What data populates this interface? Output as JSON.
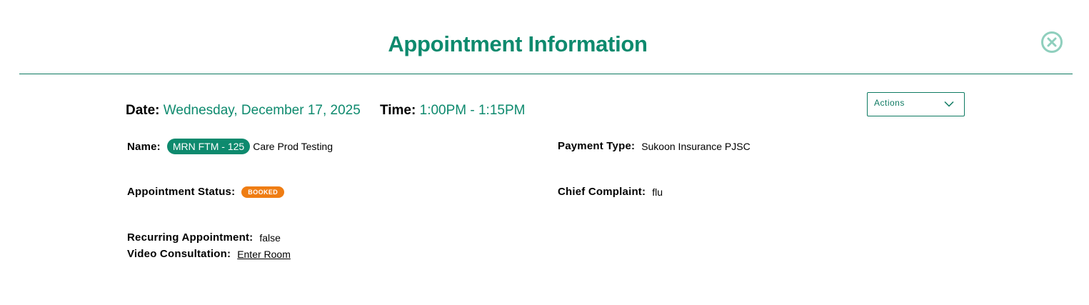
{
  "modal": {
    "title": "Appointment Information",
    "close_icon": "close-circle-icon"
  },
  "schedule": {
    "date_label": "Date:",
    "date_value": "Wednesday, December 17, 2025",
    "time_label": "Time:",
    "time_value": "1:00PM - 1:15PM"
  },
  "actions": {
    "label": "Actions",
    "icon": "chevron-down-icon"
  },
  "details": {
    "name_label": "Name:",
    "mrn_badge": "MRN FTM - 125",
    "name_value": "Care Prod Testing",
    "payment_label": "Payment Type:",
    "payment_value": "Sukoon Insurance PJSC",
    "status_label": "Appointment Status:",
    "status_value": "BOOKED",
    "complaint_label": "Chief Complaint:",
    "complaint_value": "flu",
    "recurring_label": "Recurring Appointment:",
    "recurring_value": "false",
    "video_label": "Video Consultation:",
    "video_link": "Enter Room"
  },
  "colors": {
    "accent": "#0e8a6e",
    "status_booked": "#ef7d13"
  }
}
